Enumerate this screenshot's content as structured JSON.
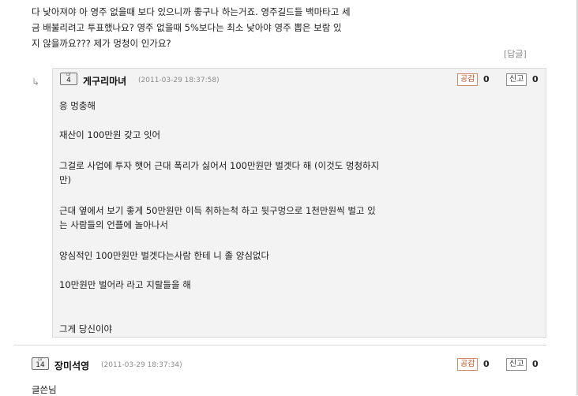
{
  "parent_comment": {
    "lines": [
      "다 낮아져야 아 영주 없을때 보다 있으니까 좋구나 하는거죠. 영주길드들 백마타고 세",
      "금 배불리려고 투표했나요? 영주 없을때 5%보다는 최소 낮아야 영주 뽑은 보람 있",
      "지 않을까요??? 제가 멍청이 인가요?"
    ],
    "reply_label": "[답글]"
  },
  "reply_comment": {
    "arrow_icon": "↳",
    "level_label": "LV",
    "level": "4",
    "author": "게구리마녀",
    "date": "(2011-03-29 18:37:58)",
    "agree_label": "공감",
    "agree_count": "0",
    "report_label": "신고",
    "report_count": "0",
    "body": [
      "응 멍충해",
      "재산이 100만원 갖고 잇어",
      "그걸로 사업에 투자 햇어  근대 폭리가 싫어서 100만원만 벌겟다 해 (이것도 멍청하지",
      "만)",
      "근대 옆에서 보기 좋게 50만원만 이득 취하는척 하고 뒷구멍으로 1천만원씩 벌고 있",
      "는 사람들의 언플에 놀아나서",
      "양심적인 100만원만 벌겟다는사람 한테 니 졸 양심없다",
      "10만원만 벌어라 라고 지랄들을 해",
      "그게 당신이야"
    ]
  },
  "next_comment": {
    "level_label": "LV",
    "level": "14",
    "author": "장미석영",
    "date": "(2011-03-29 18:37:34)",
    "agree_label": "공감",
    "agree_count": "0",
    "report_label": "신고",
    "report_count": "0",
    "body_first_line": "글쓴님"
  }
}
